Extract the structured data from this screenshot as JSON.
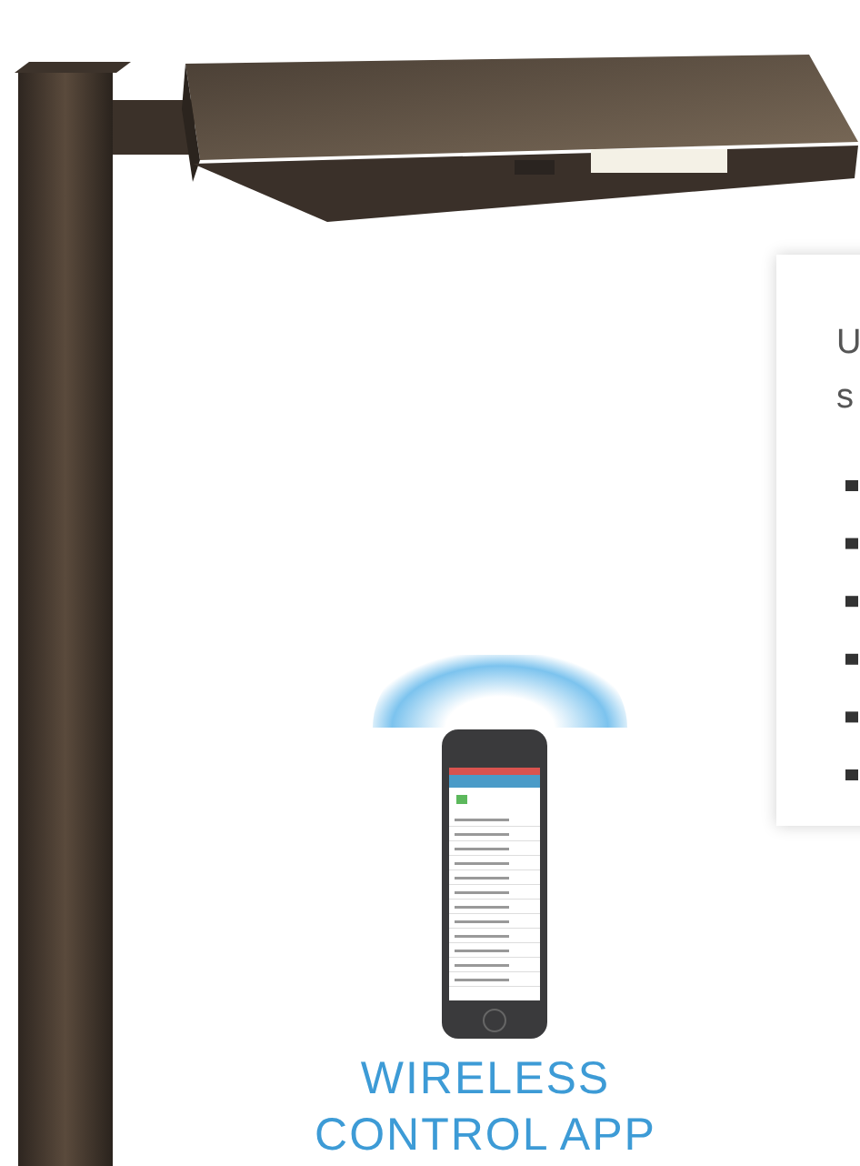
{
  "card": {
    "lines": [
      "U",
      "s"
    ]
  },
  "caption": {
    "lines": [
      "WIRELESS",
      "CONTROL APP"
    ]
  }
}
